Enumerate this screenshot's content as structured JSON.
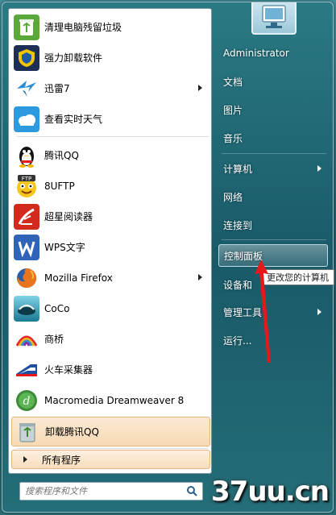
{
  "programs": [
    {
      "label": "清理电脑残留垃圾",
      "icon": "recycle-cleaner-icon",
      "color": "#5aa83a",
      "submenu": false
    },
    {
      "label": "强力卸载软件",
      "icon": "shield-uninstall-icon",
      "color": "#1d5aa8",
      "submenu": false
    },
    {
      "label": "迅雷7",
      "icon": "thunder-bird-icon",
      "color": "#2a8fd6",
      "submenu": true
    },
    {
      "label": "查看实时天气",
      "icon": "weather-cloud-icon",
      "color": "#2d9ae0",
      "submenu": false
    },
    {
      "label": "腾讯QQ",
      "icon": "qq-penguin-icon",
      "color": "#222222",
      "submenu": false
    },
    {
      "label": "8UFTP",
      "icon": "ftp-emoji-icon",
      "color": "#f2b51c",
      "submenu": false
    },
    {
      "label": "超星阅读器",
      "icon": "superstar-reader-icon",
      "color": "#d32a1e",
      "submenu": false
    },
    {
      "label": "WPS文字",
      "icon": "wps-writer-icon",
      "color": "#2f64b8",
      "submenu": false
    },
    {
      "label": "Mozilla Firefox",
      "icon": "firefox-icon",
      "color": "#e8741d",
      "submenu": true
    },
    {
      "label": "CoCo",
      "icon": "coco-icon",
      "color": "#2fa3c3",
      "submenu": false
    },
    {
      "label": "商桥",
      "icon": "shangqiao-rainbow-icon",
      "color": "#c23a9a",
      "submenu": false
    },
    {
      "label": "火车采集器",
      "icon": "train-collector-icon",
      "color": "#1f4fa0",
      "submenu": false
    },
    {
      "label": "Macromedia Dreamweaver 8",
      "icon": "dreamweaver-icon",
      "color": "#3e8a3a",
      "submenu": false
    },
    {
      "label": "卸载腾讯QQ",
      "icon": "recycle-bin-icon",
      "color": "#6c8a8f",
      "submenu": false
    }
  ],
  "all_programs": "所有程序",
  "search": {
    "placeholder": "搜索程序和文件"
  },
  "right": {
    "items": [
      {
        "label": "Administrator",
        "submenu": false
      },
      {
        "label": "文档",
        "submenu": false
      },
      {
        "label": "图片",
        "submenu": false
      },
      {
        "label": "音乐",
        "submenu": false
      },
      {
        "label": "计算机",
        "submenu": true
      },
      {
        "label": "网络",
        "submenu": false
      },
      {
        "label": "连接到",
        "submenu": false
      },
      {
        "label": "控制面板",
        "submenu": false
      },
      {
        "label": "设备和",
        "submenu": false
      },
      {
        "label": "管理工具",
        "submenu": true
      },
      {
        "label": "运行...",
        "submenu": false
      }
    ]
  },
  "tooltip": "更改您的计算机",
  "watermark": "37uu.cn",
  "colors": {
    "highlight": "#f7d9b4",
    "arrow_red": "#e21a1a"
  }
}
